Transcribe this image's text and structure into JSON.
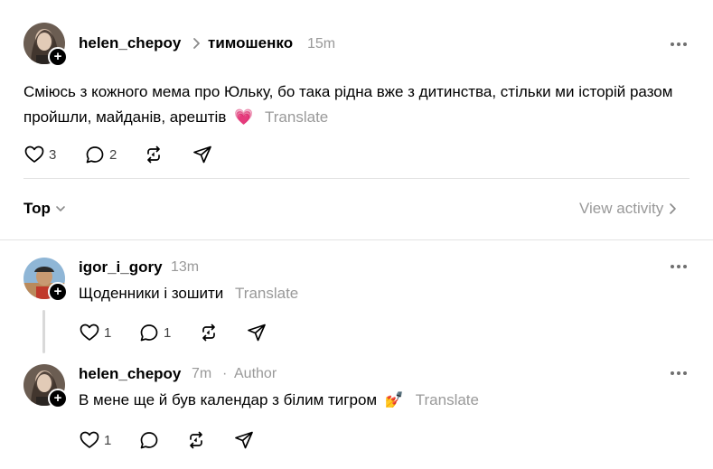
{
  "post": {
    "author": "helen_chepoy",
    "separator": ">",
    "reply_target": "тимошенко",
    "time": "15m",
    "text": "Сміюсь з кожного мема про Юльку, бо така рідна вже з дитинства, стільки ми історій разом пройшли, майданів, арештів",
    "emoji": "💗",
    "translate": "Translate",
    "likes": "3",
    "replies": "2"
  },
  "sort": {
    "label": "Top",
    "view_activity": "View activity"
  },
  "comments": [
    {
      "author": "igor_i_gory",
      "time": "13m",
      "text": "Щоденники і зошити",
      "translate": "Translate",
      "likes": "1",
      "replies": "1"
    },
    {
      "author": "helen_chepoy",
      "time": "7m",
      "dot": "·",
      "badge": "Author",
      "text": "В мене ще й був календар з білим тигром",
      "emoji": "💅",
      "translate": "Translate",
      "likes": "1"
    }
  ],
  "icons": {
    "like": "heart-icon",
    "reply": "comment-icon",
    "repost": "repost-icon",
    "share": "send-icon",
    "more": "more-icon",
    "chevron": "chevron-icon",
    "follow": "plus-icon"
  }
}
